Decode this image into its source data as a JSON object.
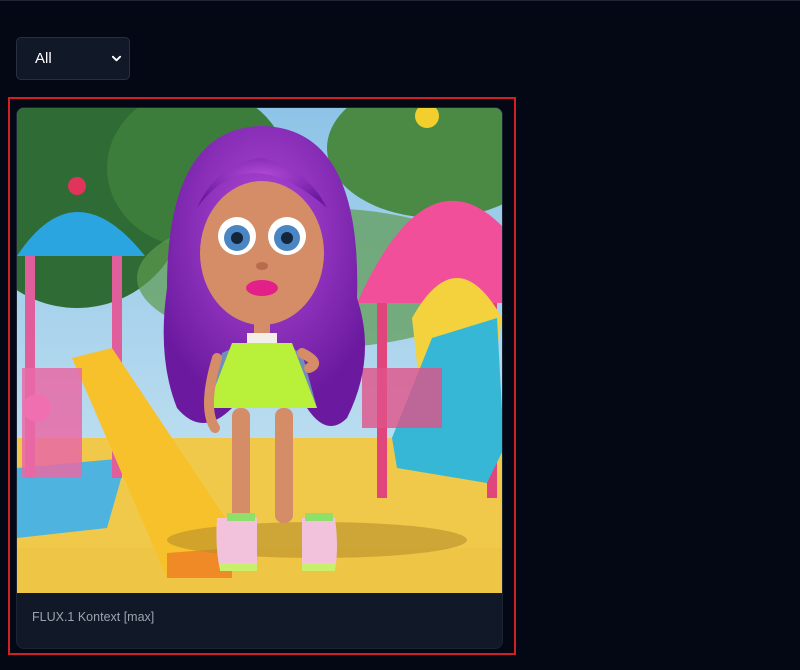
{
  "filter": {
    "selected": "All"
  },
  "gallery": {
    "items": [
      {
        "caption": "FLUX.1 Kontext [max]",
        "image_subject": "doll-figure-with-purple-hair-at-playground"
      }
    ]
  },
  "colors": {
    "page_background": "#040714",
    "card_background": "#111827",
    "highlight_border": "#d11f24",
    "caption_text": "#9ca3af"
  }
}
